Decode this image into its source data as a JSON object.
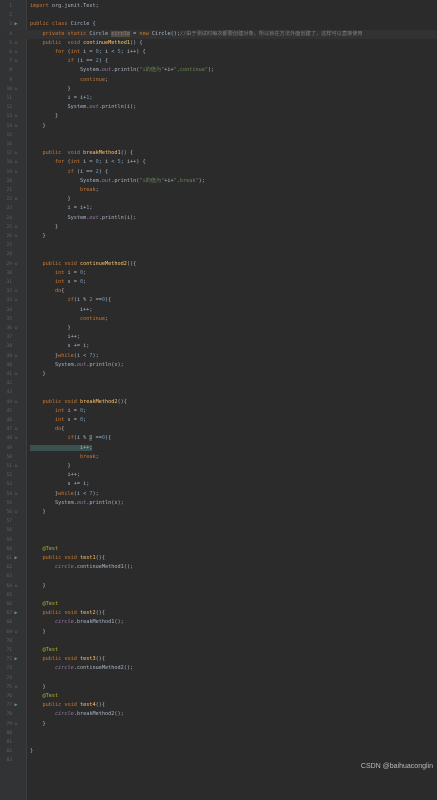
{
  "editor": {
    "lines": [
      {
        "n": "1",
        "text": "import org.junit.Test;"
      },
      {
        "n": "2",
        "text": ""
      },
      {
        "n": "3",
        "text": "public class Circle {"
      },
      {
        "n": "4",
        "text": "    private static Circle circle = new Circle();//由于测试时每次都要创建对象，所以就在方法外面创建了，这样可以直接使用"
      },
      {
        "n": "5",
        "text": "    public  void continueMethod1() {"
      },
      {
        "n": "6",
        "text": "        for (int i = 0; i < 5; i++) {"
      },
      {
        "n": "7",
        "text": "            if (i == 2) {"
      },
      {
        "n": "8",
        "text": "                System.out.println(\"i的值为\"+i+\",continue\");"
      },
      {
        "n": "9",
        "text": "                continue;"
      },
      {
        "n": "10",
        "text": "            }"
      },
      {
        "n": "11",
        "text": "            i = i+1;"
      },
      {
        "n": "12",
        "text": "            System.out.println(i);"
      },
      {
        "n": "13",
        "text": "        }"
      },
      {
        "n": "14",
        "text": "    }"
      },
      {
        "n": "15",
        "text": ""
      },
      {
        "n": "16",
        "text": ""
      },
      {
        "n": "17",
        "text": "    public  void breakMethod1() {"
      },
      {
        "n": "18",
        "text": "        for (int i = 0; i < 5; i++) {"
      },
      {
        "n": "19",
        "text": "            if (i == 2) {"
      },
      {
        "n": "20",
        "text": "                System.out.println(\"i的值为\"+i+\",break\");"
      },
      {
        "n": "21",
        "text": "                break;"
      },
      {
        "n": "22",
        "text": "            }"
      },
      {
        "n": "23",
        "text": "            i = i+1;"
      },
      {
        "n": "24",
        "text": "            System.out.println(i);"
      },
      {
        "n": "25",
        "text": "        }"
      },
      {
        "n": "26",
        "text": "    }"
      },
      {
        "n": "27",
        "text": ""
      },
      {
        "n": "28",
        "text": ""
      },
      {
        "n": "29",
        "text": "    public void continueMethod2(){"
      },
      {
        "n": "30",
        "text": "        int i = 0;"
      },
      {
        "n": "31",
        "text": "        int s = 0;"
      },
      {
        "n": "32",
        "text": "        do{"
      },
      {
        "n": "33",
        "text": "            if(i % 2 ==0){"
      },
      {
        "n": "34",
        "text": "                i++;"
      },
      {
        "n": "35",
        "text": "                continue;"
      },
      {
        "n": "36",
        "text": "            }"
      },
      {
        "n": "37",
        "text": "            i++;"
      },
      {
        "n": "38",
        "text": "            s += i;"
      },
      {
        "n": "39",
        "text": "        }while(i < 7);"
      },
      {
        "n": "40",
        "text": "        System.out.println(s);"
      },
      {
        "n": "41",
        "text": "    }"
      },
      {
        "n": "42",
        "text": ""
      },
      {
        "n": "43",
        "text": ""
      },
      {
        "n": "44",
        "text": "    public void breakMethod2(){"
      },
      {
        "n": "45",
        "text": "        int i = 0;"
      },
      {
        "n": "46",
        "text": "        int s = 0;"
      },
      {
        "n": "47",
        "text": "        do{"
      },
      {
        "n": "48",
        "text": "            if(i % 2 ==0){"
      },
      {
        "n": "49",
        "text": "                i++;"
      },
      {
        "n": "50",
        "text": "                break;"
      },
      {
        "n": "51",
        "text": "            }"
      },
      {
        "n": "52",
        "text": "            i++;"
      },
      {
        "n": "53",
        "text": "            s += i;"
      },
      {
        "n": "54",
        "text": "        }while(i < 7);"
      },
      {
        "n": "55",
        "text": "        System.out.println(s);"
      },
      {
        "n": "56",
        "text": "    }"
      },
      {
        "n": "57",
        "text": ""
      },
      {
        "n": "58",
        "text": ""
      },
      {
        "n": "59",
        "text": ""
      },
      {
        "n": "60",
        "text": "    @Test"
      },
      {
        "n": "61",
        "text": "    public void test1(){"
      },
      {
        "n": "62",
        "text": "        circle.continueMethod1();"
      },
      {
        "n": "63",
        "text": ""
      },
      {
        "n": "64",
        "text": "    }"
      },
      {
        "n": "65",
        "text": ""
      },
      {
        "n": "66",
        "text": "    @Test"
      },
      {
        "n": "67",
        "text": "    public void test2(){"
      },
      {
        "n": "68",
        "text": "        circle.breakMethod1();"
      },
      {
        "n": "69",
        "text": "    }"
      },
      {
        "n": "70",
        "text": ""
      },
      {
        "n": "71",
        "text": "    @Test"
      },
      {
        "n": "72",
        "text": "    public void test3(){"
      },
      {
        "n": "73",
        "text": "        circle.continueMethod2();"
      },
      {
        "n": "74",
        "text": ""
      },
      {
        "n": "75",
        "text": "    }"
      },
      {
        "n": "76",
        "text": "    @Test"
      },
      {
        "n": "77",
        "text": "    public void test4(){"
      },
      {
        "n": "78",
        "text": "        circle.breakMethod2();"
      },
      {
        "n": "79",
        "text": "    }"
      },
      {
        "n": "80",
        "text": ""
      },
      {
        "n": "81",
        "text": ""
      },
      {
        "n": "82",
        "text": "}"
      },
      {
        "n": "83",
        "text": ""
      }
    ],
    "run_icon_lines": [
      3,
      61,
      67,
      72,
      77
    ],
    "fold_icon_lines": [
      5,
      6,
      7,
      10,
      13,
      14,
      17,
      18,
      19,
      22,
      25,
      26,
      29,
      32,
      33,
      36,
      39,
      41,
      44,
      47,
      48,
      51,
      54,
      56,
      61,
      64,
      67,
      69,
      72,
      75,
      77,
      79
    ],
    "current_line": 4,
    "colors": {
      "background": "#2b2b2b",
      "keyword": "#cc7832",
      "number": "#6897bb",
      "string": "#6a8759",
      "annotation": "#bbb529",
      "field": "#9876aa",
      "method": "#ffc66d",
      "comment": "#808080"
    }
  },
  "watermark": "CSDN @baihuaconglin"
}
